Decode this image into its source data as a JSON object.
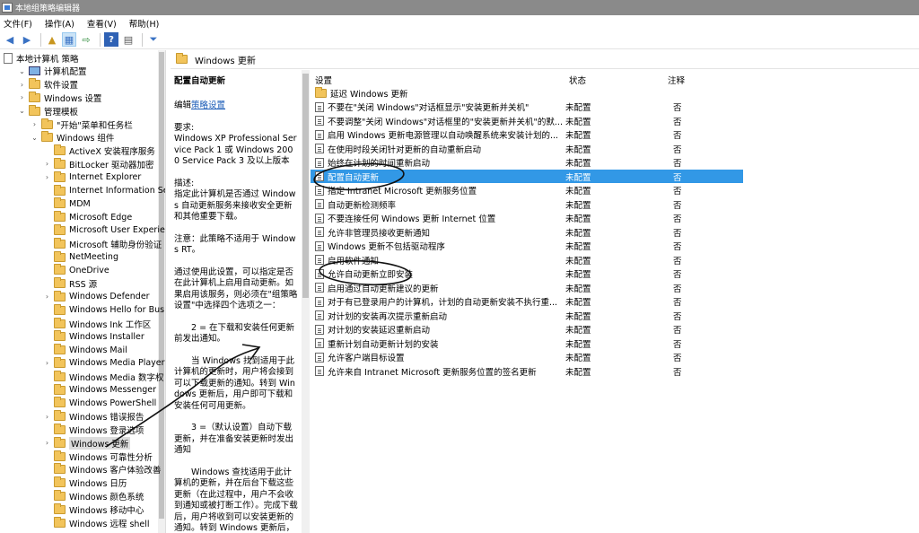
{
  "window": {
    "title": "本地组策略编辑器"
  },
  "menu": [
    "文件(F)",
    "操作(A)",
    "查看(V)",
    "帮助(H)"
  ],
  "toolbar": [
    {
      "icon": "back-arrow-icon",
      "glyph": "◀"
    },
    {
      "icon": "forward-arrow-icon",
      "glyph": "▶"
    },
    {
      "icon": "folder-up-icon",
      "glyph": "▲"
    },
    {
      "icon": "console-tree-icon",
      "glyph": "▦"
    },
    {
      "icon": "export-list-icon",
      "glyph": "⇨"
    },
    {
      "icon": "help-icon",
      "glyph": "?"
    },
    {
      "icon": "properties-icon",
      "glyph": "▤"
    },
    {
      "icon": "filter-icon",
      "glyph": "⏷"
    }
  ],
  "tree": [
    {
      "label": "本地计算机 策略",
      "level": 0,
      "exp": "",
      "icon": "doc"
    },
    {
      "label": "计算机配置",
      "level": 1,
      "exp": "⌄",
      "icon": "comp"
    },
    {
      "label": "软件设置",
      "level": 2,
      "exp": "›",
      "icon": "folder"
    },
    {
      "label": "Windows 设置",
      "level": 2,
      "exp": "›",
      "icon": "folder"
    },
    {
      "label": "管理模板",
      "level": 2,
      "exp": "⌄",
      "icon": "folder"
    },
    {
      "label": "\"开始\"菜单和任务栏",
      "level": 3,
      "exp": "›",
      "icon": "folder"
    },
    {
      "label": "Windows 组件",
      "level": 3,
      "exp": "⌄",
      "icon": "folder"
    },
    {
      "label": "ActiveX 安装程序服务",
      "level": 4,
      "exp": "",
      "icon": "folder"
    },
    {
      "label": "BitLocker 驱动器加密",
      "level": 4,
      "exp": "›",
      "icon": "folder"
    },
    {
      "label": "Internet Explorer",
      "level": 4,
      "exp": "›",
      "icon": "folder"
    },
    {
      "label": "Internet Information Se",
      "level": 4,
      "exp": "",
      "icon": "folder"
    },
    {
      "label": "MDM",
      "level": 4,
      "exp": "",
      "icon": "folder"
    },
    {
      "label": "Microsoft Edge",
      "level": 4,
      "exp": "",
      "icon": "folder"
    },
    {
      "label": "Microsoft User Experie",
      "level": 4,
      "exp": "",
      "icon": "folder"
    },
    {
      "label": "Microsoft 辅助身份验证",
      "level": 4,
      "exp": "",
      "icon": "folder"
    },
    {
      "label": "NetMeeting",
      "level": 4,
      "exp": "",
      "icon": "folder"
    },
    {
      "label": "OneDrive",
      "level": 4,
      "exp": "",
      "icon": "folder"
    },
    {
      "label": "RSS 源",
      "level": 4,
      "exp": "",
      "icon": "folder"
    },
    {
      "label": "Windows Defender",
      "level": 4,
      "exp": "›",
      "icon": "folder"
    },
    {
      "label": "Windows Hello for Bus",
      "level": 4,
      "exp": "",
      "icon": "folder"
    },
    {
      "label": "Windows Ink 工作区",
      "level": 4,
      "exp": "",
      "icon": "folder"
    },
    {
      "label": "Windows Installer",
      "level": 4,
      "exp": "",
      "icon": "folder"
    },
    {
      "label": "Windows Mail",
      "level": 4,
      "exp": "",
      "icon": "folder"
    },
    {
      "label": "Windows Media Player",
      "level": 4,
      "exp": "›",
      "icon": "folder"
    },
    {
      "label": "Windows Media 数字权",
      "level": 4,
      "exp": "",
      "icon": "folder"
    },
    {
      "label": "Windows Messenger",
      "level": 4,
      "exp": "",
      "icon": "folder"
    },
    {
      "label": "Windows PowerShell",
      "level": 4,
      "exp": "",
      "icon": "folder"
    },
    {
      "label": "Windows 错误报告",
      "level": 4,
      "exp": "›",
      "icon": "folder"
    },
    {
      "label": "Windows 登录选项",
      "level": 4,
      "exp": "",
      "icon": "folder"
    },
    {
      "label": "Windows 更新",
      "level": 4,
      "exp": "›",
      "icon": "folder",
      "selected": true
    },
    {
      "label": "Windows 可靠性分析",
      "level": 4,
      "exp": "",
      "icon": "folder"
    },
    {
      "label": "Windows 客户体验改善",
      "level": 4,
      "exp": "",
      "icon": "folder"
    },
    {
      "label": "Windows 日历",
      "level": 4,
      "exp": "",
      "icon": "folder"
    },
    {
      "label": "Windows 颜色系统",
      "level": 4,
      "exp": "",
      "icon": "folder"
    },
    {
      "label": "Windows 移动中心",
      "level": 4,
      "exp": "",
      "icon": "folder"
    },
    {
      "label": "Windows 远程 shell",
      "level": 4,
      "exp": "",
      "icon": "folder"
    }
  ],
  "header": {
    "title": "Windows 更新"
  },
  "description": {
    "title": "配置自动更新",
    "edit_prefix": "编辑",
    "edit_link": "策略设置",
    "paragraphs": [
      "要求:\nWindows XP Professional Service Pack 1 或 Windows 2000 Service Pack 3 及以上版本",
      "描述:\n指定此计算机是否通过 Windows 自动更新服务来接收安全更新和其他重要下载。",
      "注意：此策略不适用于 Windows RT。",
      "通过使用此设置，可以指定是否在此计算机上启用自动更新。如果启用该服务，则必须在\"组策略设置\"中选择四个选项之一：",
      "2 = 在下载和安装任何更新前发出通知。",
      "当 Windows 找到适用于此计算机的更新时，用户将会接到可以下载更新的通知。转到 Windows 更新后，用户即可下载和安装任何可用更新。",
      "3 =（默认设置）自动下载更新，并在准备安装更新时发出通知",
      "Windows 查找适用于此计算机的更新，并在后台下载这些更新（在此过程中，用户不会收到通知或被打断工作）。完成下载后，用户将收到可以安装更新的通知。转到 Windows 更新后，用户即可安装更新。"
    ]
  },
  "list": {
    "columns": {
      "name": "设置",
      "state": "状态",
      "note": "注释"
    },
    "rows": [
      {
        "name": "延迟 Windows 更新",
        "state": "",
        "note": "",
        "icon": "folder"
      },
      {
        "name": "不要在\"关闭 Windows\"对话框显示\"安装更新并关机\"",
        "state": "未配置",
        "note": "否",
        "icon": "policy"
      },
      {
        "name": "不要调整\"关闭 Windows\"对话框里的\"安装更新并关机\"的默...",
        "state": "未配置",
        "note": "否",
        "icon": "policy"
      },
      {
        "name": "启用 Windows 更新电源管理以自动唤醒系统来安装计划的...",
        "state": "未配置",
        "note": "否",
        "icon": "policy"
      },
      {
        "name": "在使用时段关闭针对更新的自动重新启动",
        "state": "未配置",
        "note": "否",
        "icon": "policy"
      },
      {
        "name": "始终在计划的时间重新启动",
        "state": "未配置",
        "note": "否",
        "icon": "policy"
      },
      {
        "name": "配置自动更新",
        "state": "未配置",
        "note": "否",
        "icon": "policy",
        "selected": true
      },
      {
        "name": "指定 Intranet Microsoft 更新服务位置",
        "state": "未配置",
        "note": "否",
        "icon": "policy"
      },
      {
        "name": "自动更新检测频率",
        "state": "未配置",
        "note": "否",
        "icon": "policy"
      },
      {
        "name": "不要连接任何 Windows 更新 Internet 位置",
        "state": "未配置",
        "note": "否",
        "icon": "policy"
      },
      {
        "name": "允许非管理员接收更新通知",
        "state": "未配置",
        "note": "否",
        "icon": "policy"
      },
      {
        "name": "Windows 更新不包括驱动程序",
        "state": "未配置",
        "note": "否",
        "icon": "policy"
      },
      {
        "name": "启用软件通知",
        "state": "未配置",
        "note": "否",
        "icon": "policy"
      },
      {
        "name": "允许自动更新立即安装",
        "state": "未配置",
        "note": "否",
        "icon": "policy"
      },
      {
        "name": "启用通过自动更新建议的更新",
        "state": "未配置",
        "note": "否",
        "icon": "policy"
      },
      {
        "name": "对于有已登录用户的计算机，计划的自动更新安装不执行重...",
        "state": "未配置",
        "note": "否",
        "icon": "policy"
      },
      {
        "name": "对计划的安装再次提示重新启动",
        "state": "未配置",
        "note": "否",
        "icon": "policy"
      },
      {
        "name": "对计划的安装延迟重新启动",
        "state": "未配置",
        "note": "否",
        "icon": "policy"
      },
      {
        "name": "重新计划自动更新计划的安装",
        "state": "未配置",
        "note": "否",
        "icon": "policy"
      },
      {
        "name": "允许客户端目标设置",
        "state": "未配置",
        "note": "否",
        "icon": "policy"
      },
      {
        "name": "允许来自 Intranet Microsoft 更新服务位置的签名更新",
        "state": "未配置",
        "note": "否",
        "icon": "policy"
      }
    ]
  }
}
